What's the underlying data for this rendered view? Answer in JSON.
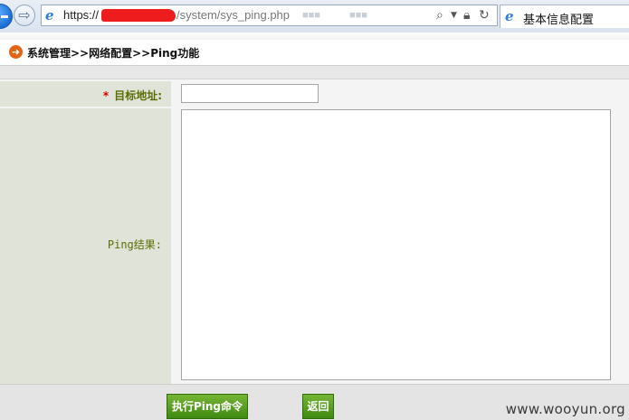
{
  "browser": {
    "url_protocol": "https://",
    "url_path": "/system/sys_ping.php",
    "tab_title": "基本信息配置"
  },
  "breadcrumb": {
    "text": "系统管理>>网络配置>>Ping功能"
  },
  "form": {
    "target_label": "目标地址:",
    "target_required_mark": "*",
    "target_value": "",
    "result_label": "Ping结果:",
    "result_value": ""
  },
  "buttons": {
    "execute_label": "执行Ping命令",
    "back_label": "返回"
  },
  "watermark": "www.wooyun.org",
  "colors": {
    "label_text": "#5a6e06",
    "label_bg": "#dfe3d8",
    "button_green": "#4c9a1c",
    "required_red": "#d00000",
    "breadcrumb_arrow": "#e16513"
  }
}
